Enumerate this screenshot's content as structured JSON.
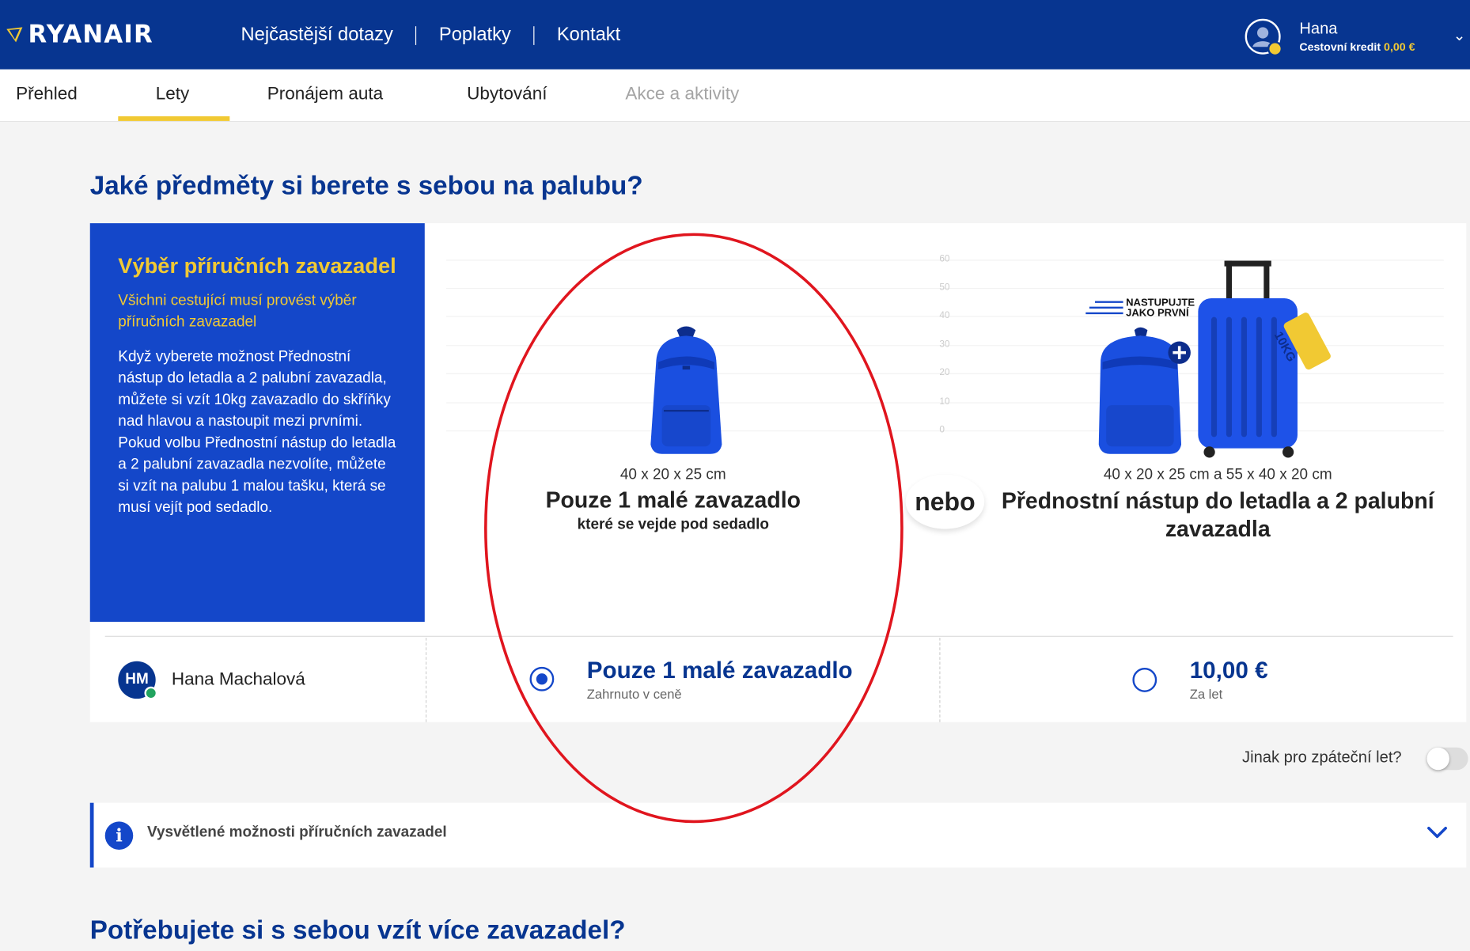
{
  "header": {
    "brand": "RYANAIR",
    "nav": [
      "Nejčastější dotazy",
      "Poplatky",
      "Kontakt"
    ],
    "user": {
      "name": "Hana",
      "credit_label": "Cestovní kredit",
      "credit_value": "0,00 €"
    }
  },
  "tabs": [
    {
      "label": "Přehled",
      "state": "normal"
    },
    {
      "label": "Lety",
      "state": "active"
    },
    {
      "label": "Pronájem auta",
      "state": "normal"
    },
    {
      "label": "Ubytování",
      "state": "normal"
    },
    {
      "label": "Akce a aktivity",
      "state": "disabled"
    }
  ],
  "page": {
    "title": "Jaké předměty si berete s sebou na palubu?",
    "second_title": "Potřebujete si s sebou vzít více zavazadel?"
  },
  "info_box": {
    "title": "Výběr příručních zavazadel",
    "subtitle": "Všichni cestující musí provést výběr příručních zavazadel",
    "description": "Když vyberete možnost Přednostní nástup do letadla a 2 palubní zavazadla, můžete si vzít 10kg zavazadlo do skříňky nad hlavou a nastoupit mezi prvními. Pokud volbu Přednostní nástup do letadla a 2 palubní zavazadla nezvolíte, můžete si vzít na palubu 1 malou tašku, která se musí vejít pod sedadlo."
  },
  "ruler_labels": [
    "60",
    "50",
    "40",
    "30",
    "20",
    "10",
    "0"
  ],
  "options": {
    "small": {
      "dimensions": "40 x 20 x 25 cm",
      "title": "Pouze 1 malé zavazadlo",
      "subtitle": "které se vejde pod sedadlo"
    },
    "separator": "nebo",
    "priority": {
      "dimensions": "40 x 20 x 25 cm a 55 x 40 x 20 cm",
      "title": "Přednostní nástup do letadla a 2 palubní zavazadla",
      "badge_line1": "NASTUPUJTE",
      "badge_line2": "JAKO PRVNÍ",
      "tag": "10KG"
    }
  },
  "passenger": {
    "initials": "HM",
    "name": "Hana Machalová",
    "choice_small": {
      "label": "Pouze 1 malé zavazadlo",
      "note": "Zahrnuto v ceně",
      "selected": true
    },
    "choice_priority": {
      "price": "10,00 €",
      "note": "Za let",
      "selected": false
    }
  },
  "return_toggle": {
    "label": "Jinak pro zpáteční let?",
    "on": false
  },
  "explain_bar": {
    "text": "Vysvětlené možnosti příručních zavazadel",
    "icon": "info-icon"
  },
  "colors": {
    "brand_navy": "#073590",
    "brand_blue": "#1447c9",
    "yellow": "#f1c933",
    "annotation_red": "#e0151e"
  }
}
